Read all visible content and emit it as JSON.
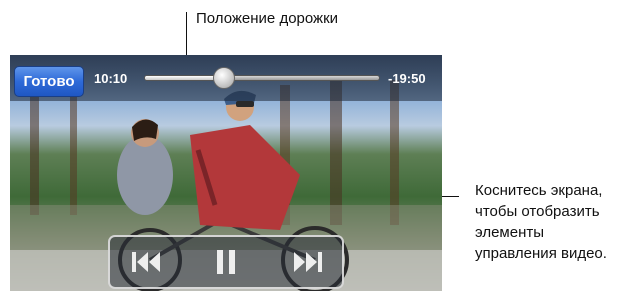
{
  "annotations": {
    "track_position": "Положение дорожки",
    "tap_screen_line1": "Коснитесь экрана,",
    "tap_screen_line2": "чтобы отобразить",
    "tap_screen_line3": "элементы",
    "tap_screen_line4": "управления видео."
  },
  "player": {
    "done_label": "Готово",
    "elapsed_time": "10:10",
    "remaining_time": "-19:50",
    "progress": 0.34,
    "controls": {
      "previous_icon": "skip-back-icon",
      "pause_icon": "pause-icon",
      "next_icon": "skip-forward-icon"
    }
  }
}
